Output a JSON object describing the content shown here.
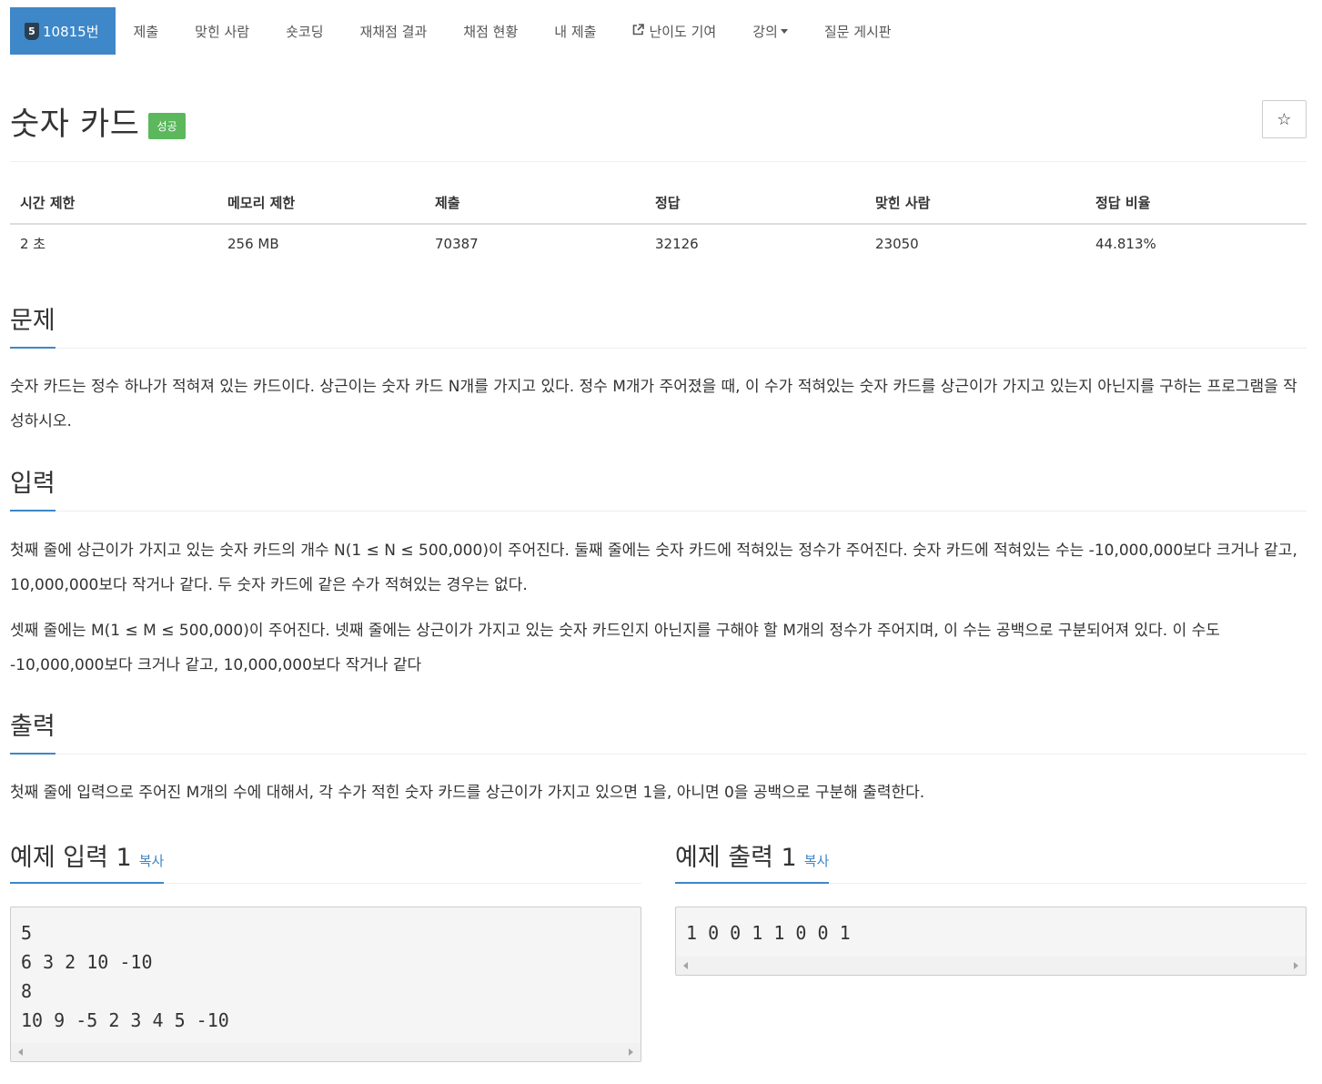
{
  "nav": {
    "problem_id": "10815번",
    "tier_level": "5",
    "items": [
      "제출",
      "맞힌 사람",
      "숏코딩",
      "재채점 결과",
      "채점 현황",
      "내 제출",
      "난이도 기여",
      "강의",
      "질문 게시판"
    ]
  },
  "problem": {
    "title": "숫자 카드",
    "status_badge": "성공",
    "star": "☆"
  },
  "info_table": {
    "headers": [
      "시간 제한",
      "메모리 제한",
      "제출",
      "정답",
      "맞힌 사람",
      "정답 비율"
    ],
    "values": [
      "2 초",
      "256 MB",
      "70387",
      "32126",
      "23050",
      "44.813%"
    ]
  },
  "sections": {
    "description": {
      "title": "문제",
      "text": "숫자 카드는 정수 하나가 적혀져 있는 카드이다. 상근이는 숫자 카드 N개를 가지고 있다. 정수 M개가 주어졌을 때, 이 수가 적혀있는 숫자 카드를 상근이가 가지고 있는지 아닌지를 구하는 프로그램을 작성하시오."
    },
    "input": {
      "title": "입력",
      "p1": "첫째 줄에 상근이가 가지고 있는 숫자 카드의 개수 N(1 ≤ N ≤ 500,000)이 주어진다. 둘째 줄에는 숫자 카드에 적혀있는 정수가 주어진다. 숫자 카드에 적혀있는 수는 -10,000,000보다 크거나 같고, 10,000,000보다 작거나 같다. 두 숫자 카드에 같은 수가 적혀있는 경우는 없다.",
      "p2": "셋째 줄에는 M(1 ≤ M ≤ 500,000)이 주어진다. 넷째 줄에는 상근이가 가지고 있는 숫자 카드인지 아닌지를 구해야 할 M개의 정수가 주어지며, 이 수는 공백으로 구분되어져 있다. 이 수도 -10,000,000보다 크거나 같고, 10,000,000보다 작거나 같다"
    },
    "output": {
      "title": "출력",
      "text": "첫째 줄에 입력으로 주어진 M개의 수에 대해서, 각 수가 적힌 숫자 카드를 상근이가 가지고 있으면 1을, 아니면 0을 공백으로 구분해 출력한다."
    }
  },
  "samples": {
    "input_title": "예제 입력 1",
    "output_title": "예제 출력 1",
    "copy_label": "복사",
    "input_text": "5\n6 3 2 10 -10\n8\n10 9 -5 2 3 4 5 -10",
    "output_text": "1 0 0 1 1 0 0 1"
  },
  "colors": {
    "accent": "#3e87c8",
    "success": "#5cb85c"
  }
}
